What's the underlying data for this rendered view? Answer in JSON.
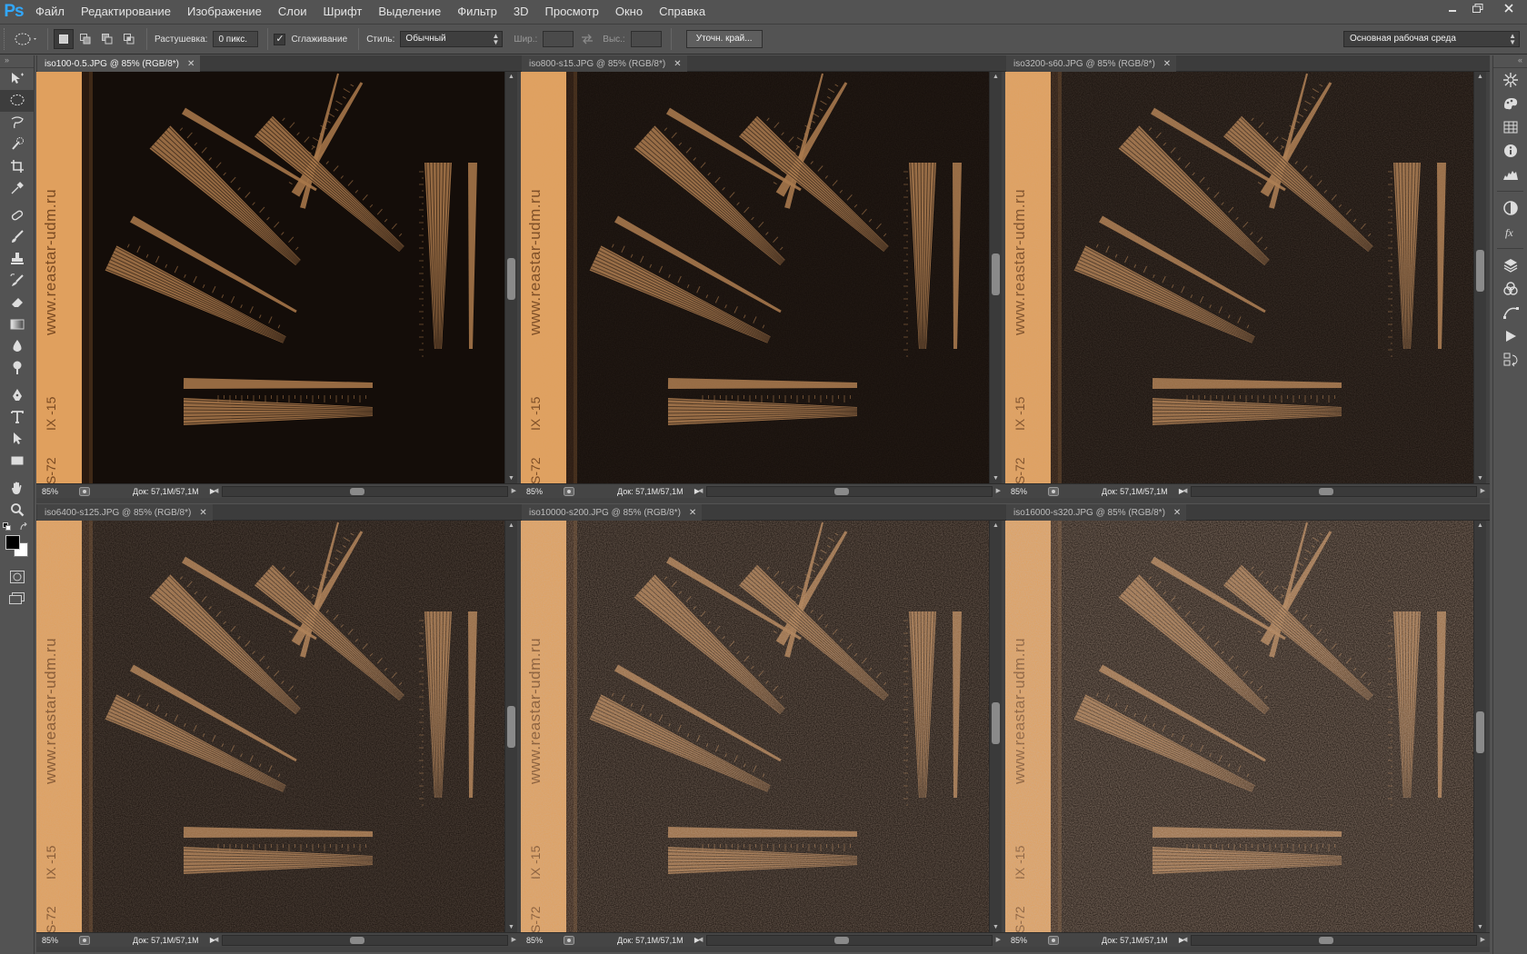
{
  "app": {
    "logo": "Ps"
  },
  "menu": [
    "Файл",
    "Редактирование",
    "Изображение",
    "Слои",
    "Шрифт",
    "Выделение",
    "Фильтр",
    "3D",
    "Просмотр",
    "Окно",
    "Справка"
  ],
  "window_controls": [
    "minimize-icon",
    "restore-icon",
    "close-icon"
  ],
  "options": {
    "feather_label": "Растушевка:",
    "feather_value": "0 пикс.",
    "antialias_label": "Сглаживание",
    "antialias_checked": true,
    "style_label": "Стиль:",
    "style_value": "Обычный",
    "width_label": "Шир.:",
    "height_label": "Выс.:",
    "refine_button": "Уточн. край...",
    "workspace": "Основная рабочая среда"
  },
  "documents": [
    {
      "title": "iso100-0.5.JPG @ 85% (RGB/8*)",
      "zoom": "85%",
      "info": "Док: 57,1M/57,1M",
      "active": true,
      "noise": 0
    },
    {
      "title": "iso800-s15.JPG @ 85% (RGB/8*)",
      "zoom": "85%",
      "info": "Док: 57,1M/57,1M",
      "active": false,
      "noise": 0.1
    },
    {
      "title": "iso3200-s60.JPG @ 85% (RGB/8*)",
      "zoom": "85%",
      "info": "Док: 57,1M/57,1M",
      "active": false,
      "noise": 0.25
    },
    {
      "title": "iso6400-s125.JPG @ 85% (RGB/8*)",
      "zoom": "85%",
      "info": "Док: 57,1M/57,1M",
      "active": false,
      "noise": 0.4
    },
    {
      "title": "iso10000-s200.JPG @ 85% (RGB/8*)",
      "zoom": "85%",
      "info": "Док: 57,1M/57,1M",
      "active": false,
      "noise": 0.55
    },
    {
      "title": "iso16000-s320.JPG @ 85% (RGB/8*)",
      "zoom": "85%",
      "info": "Док: 57,1M/57,1M",
      "active": false,
      "noise": 0.7
    }
  ],
  "chart_text": {
    "url": "www.reastar-udm.ru",
    "code1": "IX -15",
    "code2": "S-72"
  },
  "colors": {
    "ui_bg": "#535353",
    "canvas_bg": "#140d09",
    "ruler_strip": "#e0a05e",
    "wedge": "#a8784a"
  },
  "tools": [
    "move-tool-icon",
    "elliptical-marquee-icon",
    "lasso-icon",
    "quick-selection-icon",
    "crop-icon",
    "eyedropper-icon",
    "spot-healing-icon",
    "brush-icon",
    "clone-stamp-icon",
    "history-brush-icon",
    "eraser-icon",
    "gradient-icon",
    "blur-icon",
    "dodge-icon",
    "pen-icon",
    "type-icon",
    "path-selection-icon",
    "rectangle-icon",
    "hand-icon",
    "zoom-icon"
  ],
  "dock_icons": [
    "navigator-icon",
    "color-icon",
    "swatches-icon",
    "info-icon",
    "histogram-icon",
    "adjustments-icon",
    "styles-icon",
    "layers-icon",
    "channels-icon",
    "paths-icon",
    "actions-icon",
    "history-icon"
  ]
}
